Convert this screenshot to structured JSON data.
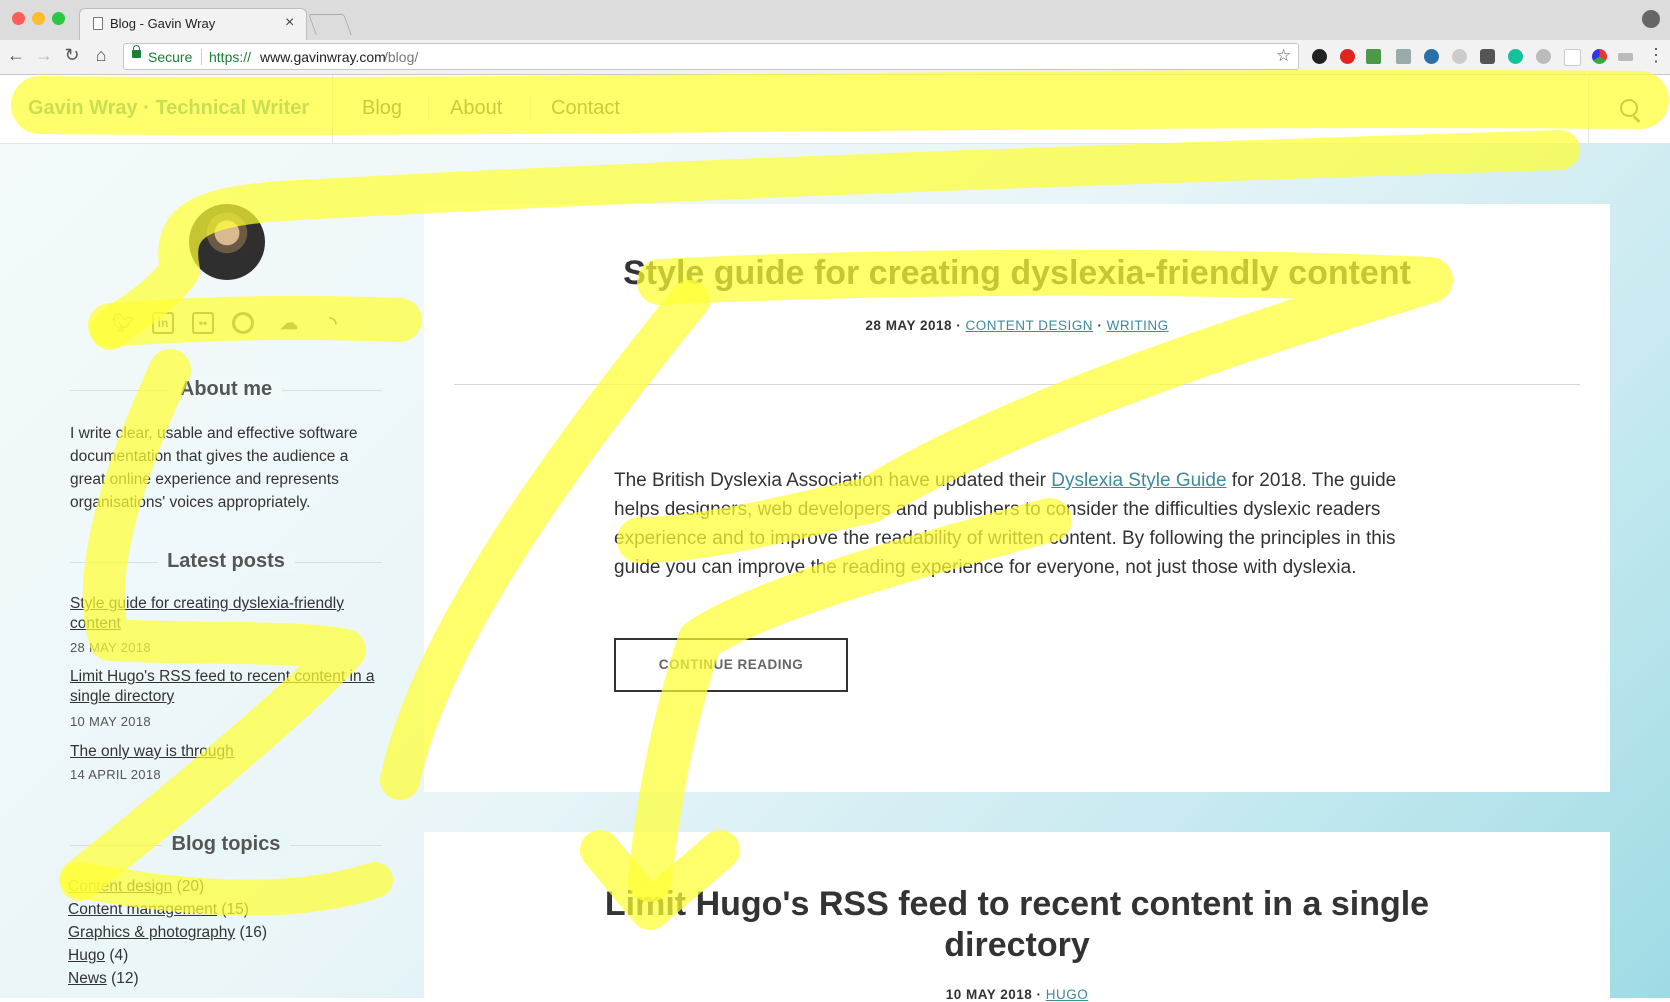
{
  "browser": {
    "tab_title": "Blog - Gavin Wray",
    "tab_close": "×",
    "secure_label": "Secure",
    "url_scheme": "https://",
    "url_host": "www.gavinwray.com",
    "url_path": "/blog/",
    "back": "←",
    "forward": "→",
    "reload": "↻",
    "home": "⌂",
    "star": "☆",
    "menu": "⋮"
  },
  "site": {
    "brand": "Gavin Wray · Technical Writer",
    "nav": [
      "Blog",
      "About",
      "Contact"
    ]
  },
  "sidebar": {
    "social_icons": [
      "twitter-icon",
      "linkedin-icon",
      "flickr-icon",
      "github-icon",
      "soundcloud-icon",
      "rss-icon"
    ],
    "about_heading": "About me",
    "about_text": "I write clear, usable and effective software documentation that gives the audience a great online experience and represents organisations' voices appropriately.",
    "latest_heading": "Latest posts",
    "latest_posts": [
      {
        "title": "Style guide for creating dyslexia-friendly content",
        "date": "28 MAY 2018"
      },
      {
        "title": "Limit Hugo's RSS feed to recent content in a single directory",
        "date": "10 MAY 2018"
      },
      {
        "title": "The only way is through",
        "date": "14 APRIL 2018"
      }
    ],
    "topics_heading": "Blog topics",
    "topics": [
      {
        "name": "Content design",
        "count": "(20)"
      },
      {
        "name": "Content management",
        "count": "(15)"
      },
      {
        "name": "Graphics & photography",
        "count": "(16)"
      },
      {
        "name": "Hugo",
        "count": "(4)"
      },
      {
        "name": "News",
        "count": "(12)"
      }
    ]
  },
  "posts": [
    {
      "title": "Style guide for creating dyslexia-friendly content",
      "date": "28 MAY 2018",
      "sep": "·",
      "categories": [
        "CONTENT DESIGN",
        "WRITING"
      ],
      "excerpt_before": "The British Dyslexia Association have updated their ",
      "excerpt_link": "Dyslexia Style Guide",
      "excerpt_after": " for 2018. The guide helps designers, web developers and publishers to consider the difficulties dyslexic readers experience and to improve the readability of written content. By following the principles in this guide you can improve the reading experience for everyone, not just those with dyslexia.",
      "button": "CONTINUE READING"
    },
    {
      "title": "Limit Hugo's RSS feed to recent content in a single directory",
      "date": "10 MAY 2018",
      "categories": [
        "HUGO"
      ]
    }
  ],
  "colors": {
    "accent": "#3f8a9b",
    "highlighter": "#ffff33"
  }
}
